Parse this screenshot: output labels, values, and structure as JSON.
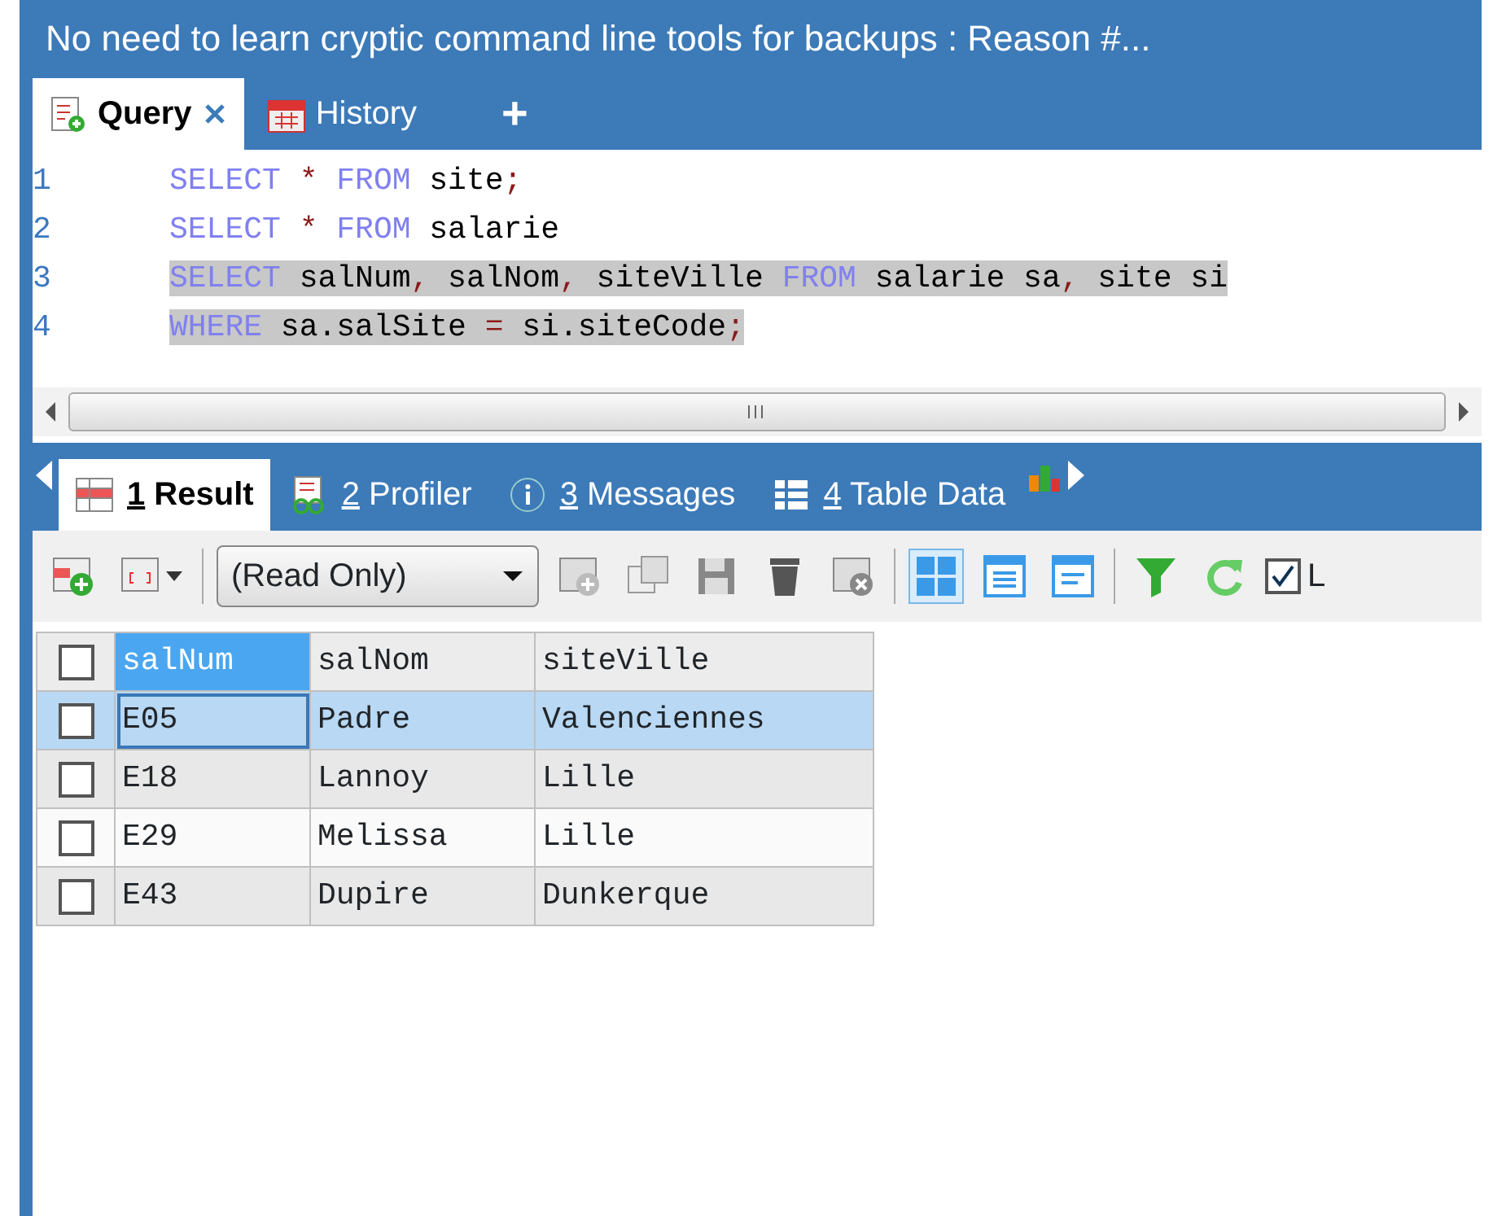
{
  "window": {
    "title": "No need to learn cryptic command line tools for backups : Reason #..."
  },
  "query_tabs": [
    {
      "label": "Query",
      "selected": true,
      "kind": "query"
    },
    {
      "label": "History",
      "selected": false,
      "kind": "history"
    }
  ],
  "add_tab": "+",
  "editor": {
    "lines": [
      {
        "number": "1",
        "selected": false,
        "tokens": [
          {
            "text": "SELECT",
            "kind": "kw"
          },
          {
            "text": " * ",
            "kind": "op"
          },
          {
            "text": "FROM",
            "kind": "kw"
          },
          {
            "text": " site",
            "kind": "id"
          },
          {
            "text": ";",
            "kind": "op"
          }
        ]
      },
      {
        "number": "2",
        "selected": false,
        "tokens": [
          {
            "text": "SELECT",
            "kind": "kw"
          },
          {
            "text": " * ",
            "kind": "op"
          },
          {
            "text": "FROM",
            "kind": "kw"
          },
          {
            "text": " salarie",
            "kind": "id"
          }
        ]
      },
      {
        "number": "3",
        "selected": true,
        "tokens": [
          {
            "text": "SELECT",
            "kind": "kw"
          },
          {
            "text": " salNum",
            "kind": "id"
          },
          {
            "text": ",",
            "kind": "op"
          },
          {
            "text": " salNom",
            "kind": "id"
          },
          {
            "text": ",",
            "kind": "op"
          },
          {
            "text": " siteVille ",
            "kind": "id"
          },
          {
            "text": "FROM",
            "kind": "kw"
          },
          {
            "text": " salarie sa",
            "kind": "id"
          },
          {
            "text": ",",
            "kind": "op"
          },
          {
            "text": " site si",
            "kind": "id"
          }
        ]
      },
      {
        "number": "4",
        "selected": true,
        "tokens": [
          {
            "text": "WHERE",
            "kind": "kw"
          },
          {
            "text": " sa.salSite ",
            "kind": "id"
          },
          {
            "text": "=",
            "kind": "op"
          },
          {
            "text": " si.siteCode",
            "kind": "id"
          },
          {
            "text": ";",
            "kind": "op"
          }
        ]
      }
    ]
  },
  "result_tabs": [
    {
      "number": "1",
      "label": "Result",
      "selected": true,
      "kind": "result"
    },
    {
      "number": "2",
      "label": "Profiler",
      "selected": false,
      "kind": "profiler"
    },
    {
      "number": "3",
      "label": "Messages",
      "selected": false,
      "kind": "messages"
    },
    {
      "number": "4",
      "label": "Table Data",
      "selected": false,
      "kind": "table"
    }
  ],
  "toolbar": {
    "mode_select": "(Read Only)",
    "views": [
      {
        "kind": "grid",
        "selected": true
      },
      {
        "kind": "form",
        "selected": false
      },
      {
        "kind": "text",
        "selected": false
      }
    ],
    "checkbox": {
      "label": "L",
      "checked": true
    }
  },
  "grid": {
    "select_all_checked": false,
    "columns": [
      {
        "label": "salNum",
        "selected": true
      },
      {
        "label": "salNom",
        "selected": false
      },
      {
        "label": "siteVille",
        "selected": false
      }
    ],
    "rows": [
      {
        "cells": [
          "E05",
          "Padre",
          "Valenciennes"
        ],
        "selected": true,
        "checked": false
      },
      {
        "cells": [
          "E18",
          "Lannoy",
          "Lille"
        ],
        "selected": false,
        "checked": false
      },
      {
        "cells": [
          "E29",
          "Melissa",
          "Lille"
        ],
        "selected": false,
        "checked": false
      },
      {
        "cells": [
          "E43",
          "Dupire",
          "Dunkerque"
        ],
        "selected": false,
        "checked": false
      }
    ]
  }
}
